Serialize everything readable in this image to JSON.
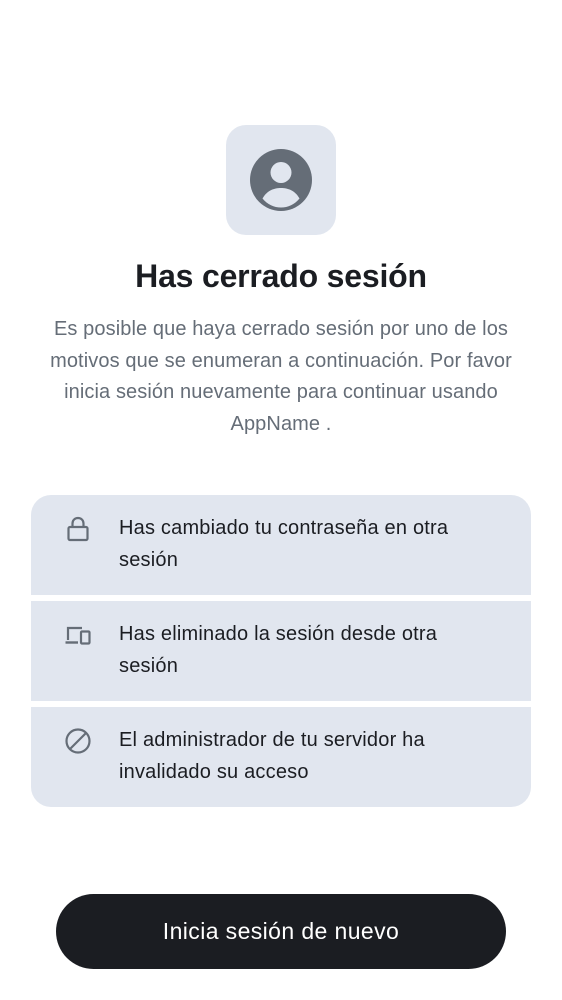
{
  "header": {
    "icon": "user-avatar-icon",
    "title": "Has cerrado sesión",
    "subtitle": "Es posible que haya cerrado sesión por uno de los motivos que se enumeran a continuación. Por favor inicia sesión nuevamente para continuar usando AppName ."
  },
  "reasons": [
    {
      "icon": "lock-icon",
      "text": "Has cambiado tu contraseña en otra sesión"
    },
    {
      "icon": "devices-icon",
      "text": "Has eliminado la sesión desde otra sesión"
    },
    {
      "icon": "block-icon",
      "text": "El administrador de tu servidor ha invalidado su acceso"
    }
  ],
  "action": {
    "label": "Inicia sesión de nuevo"
  },
  "colors": {
    "background": "#ffffff",
    "card": "#e1e6ef",
    "text_primary": "#1b1d22",
    "text_secondary": "#656d77",
    "icon": "#656d77",
    "button_bg": "#1b1d22",
    "button_text": "#ffffff"
  }
}
